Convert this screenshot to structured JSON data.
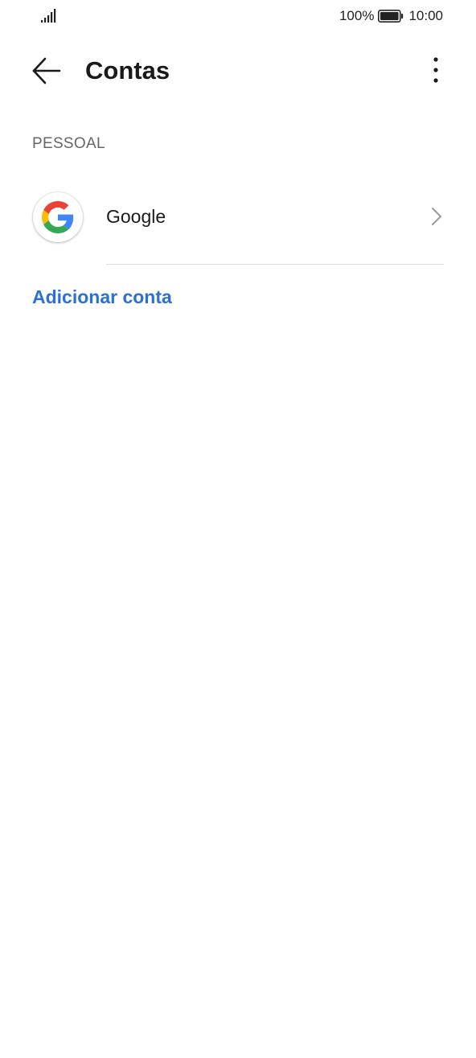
{
  "status_bar": {
    "signal_icon": "signal-bars-icon",
    "battery_percent": "100%",
    "battery_icon": "battery-full-icon",
    "time": "10:00"
  },
  "app_bar": {
    "back_icon": "arrow-left-icon",
    "title": "Contas",
    "more_icon": "more-vertical-icon"
  },
  "sections": [
    {
      "header": "PESSOAL",
      "items": [
        {
          "label": "Google",
          "icon": "google-icon",
          "trailing_icon": "chevron-right-icon"
        }
      ]
    }
  ],
  "add_account_label": "Adicionar conta",
  "colors": {
    "accent": "#2a6fdb",
    "google_blue": "#4285F4",
    "google_red": "#EA4335",
    "google_yellow": "#FBBC05",
    "google_green": "#34A853"
  }
}
